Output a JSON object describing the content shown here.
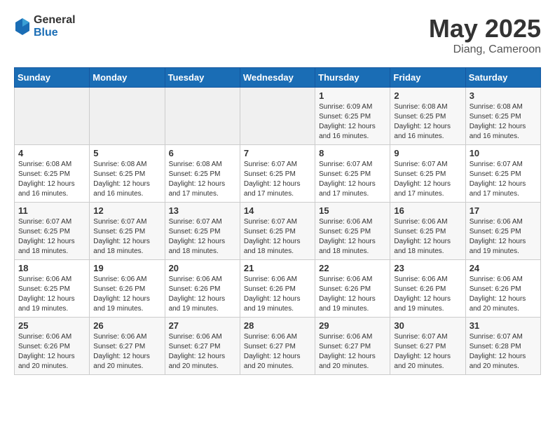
{
  "header": {
    "logo_general": "General",
    "logo_blue": "Blue",
    "month_year": "May 2025",
    "location": "Diang, Cameroon"
  },
  "days_of_week": [
    "Sunday",
    "Monday",
    "Tuesday",
    "Wednesday",
    "Thursday",
    "Friday",
    "Saturday"
  ],
  "weeks": [
    [
      {
        "day": "",
        "info": ""
      },
      {
        "day": "",
        "info": ""
      },
      {
        "day": "",
        "info": ""
      },
      {
        "day": "",
        "info": ""
      },
      {
        "day": "1",
        "info": "Sunrise: 6:09 AM\nSunset: 6:25 PM\nDaylight: 12 hours\nand 16 minutes."
      },
      {
        "day": "2",
        "info": "Sunrise: 6:08 AM\nSunset: 6:25 PM\nDaylight: 12 hours\nand 16 minutes."
      },
      {
        "day": "3",
        "info": "Sunrise: 6:08 AM\nSunset: 6:25 PM\nDaylight: 12 hours\nand 16 minutes."
      }
    ],
    [
      {
        "day": "4",
        "info": "Sunrise: 6:08 AM\nSunset: 6:25 PM\nDaylight: 12 hours\nand 16 minutes."
      },
      {
        "day": "5",
        "info": "Sunrise: 6:08 AM\nSunset: 6:25 PM\nDaylight: 12 hours\nand 16 minutes."
      },
      {
        "day": "6",
        "info": "Sunrise: 6:08 AM\nSunset: 6:25 PM\nDaylight: 12 hours\nand 17 minutes."
      },
      {
        "day": "7",
        "info": "Sunrise: 6:07 AM\nSunset: 6:25 PM\nDaylight: 12 hours\nand 17 minutes."
      },
      {
        "day": "8",
        "info": "Sunrise: 6:07 AM\nSunset: 6:25 PM\nDaylight: 12 hours\nand 17 minutes."
      },
      {
        "day": "9",
        "info": "Sunrise: 6:07 AM\nSunset: 6:25 PM\nDaylight: 12 hours\nand 17 minutes."
      },
      {
        "day": "10",
        "info": "Sunrise: 6:07 AM\nSunset: 6:25 PM\nDaylight: 12 hours\nand 17 minutes."
      }
    ],
    [
      {
        "day": "11",
        "info": "Sunrise: 6:07 AM\nSunset: 6:25 PM\nDaylight: 12 hours\nand 18 minutes."
      },
      {
        "day": "12",
        "info": "Sunrise: 6:07 AM\nSunset: 6:25 PM\nDaylight: 12 hours\nand 18 minutes."
      },
      {
        "day": "13",
        "info": "Sunrise: 6:07 AM\nSunset: 6:25 PM\nDaylight: 12 hours\nand 18 minutes."
      },
      {
        "day": "14",
        "info": "Sunrise: 6:07 AM\nSunset: 6:25 PM\nDaylight: 12 hours\nand 18 minutes."
      },
      {
        "day": "15",
        "info": "Sunrise: 6:06 AM\nSunset: 6:25 PM\nDaylight: 12 hours\nand 18 minutes."
      },
      {
        "day": "16",
        "info": "Sunrise: 6:06 AM\nSunset: 6:25 PM\nDaylight: 12 hours\nand 18 minutes."
      },
      {
        "day": "17",
        "info": "Sunrise: 6:06 AM\nSunset: 6:25 PM\nDaylight: 12 hours\nand 19 minutes."
      }
    ],
    [
      {
        "day": "18",
        "info": "Sunrise: 6:06 AM\nSunset: 6:25 PM\nDaylight: 12 hours\nand 19 minutes."
      },
      {
        "day": "19",
        "info": "Sunrise: 6:06 AM\nSunset: 6:26 PM\nDaylight: 12 hours\nand 19 minutes."
      },
      {
        "day": "20",
        "info": "Sunrise: 6:06 AM\nSunset: 6:26 PM\nDaylight: 12 hours\nand 19 minutes."
      },
      {
        "day": "21",
        "info": "Sunrise: 6:06 AM\nSunset: 6:26 PM\nDaylight: 12 hours\nand 19 minutes."
      },
      {
        "day": "22",
        "info": "Sunrise: 6:06 AM\nSunset: 6:26 PM\nDaylight: 12 hours\nand 19 minutes."
      },
      {
        "day": "23",
        "info": "Sunrise: 6:06 AM\nSunset: 6:26 PM\nDaylight: 12 hours\nand 19 minutes."
      },
      {
        "day": "24",
        "info": "Sunrise: 6:06 AM\nSunset: 6:26 PM\nDaylight: 12 hours\nand 20 minutes."
      }
    ],
    [
      {
        "day": "25",
        "info": "Sunrise: 6:06 AM\nSunset: 6:26 PM\nDaylight: 12 hours\nand 20 minutes."
      },
      {
        "day": "26",
        "info": "Sunrise: 6:06 AM\nSunset: 6:27 PM\nDaylight: 12 hours\nand 20 minutes."
      },
      {
        "day": "27",
        "info": "Sunrise: 6:06 AM\nSunset: 6:27 PM\nDaylight: 12 hours\nand 20 minutes."
      },
      {
        "day": "28",
        "info": "Sunrise: 6:06 AM\nSunset: 6:27 PM\nDaylight: 12 hours\nand 20 minutes."
      },
      {
        "day": "29",
        "info": "Sunrise: 6:06 AM\nSunset: 6:27 PM\nDaylight: 12 hours\nand 20 minutes."
      },
      {
        "day": "30",
        "info": "Sunrise: 6:07 AM\nSunset: 6:27 PM\nDaylight: 12 hours\nand 20 minutes."
      },
      {
        "day": "31",
        "info": "Sunrise: 6:07 AM\nSunset: 6:28 PM\nDaylight: 12 hours\nand 20 minutes."
      }
    ]
  ]
}
